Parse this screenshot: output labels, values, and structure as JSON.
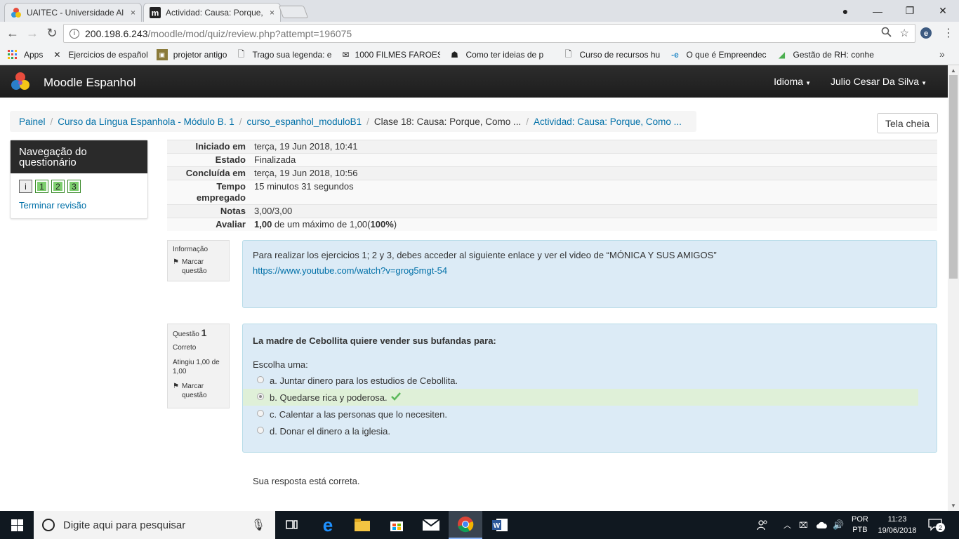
{
  "browser": {
    "tabs": [
      {
        "title": "UAITEC - Universidade Al",
        "close": "×"
      },
      {
        "title": "Actividad: Causa: Porque,",
        "close": "×"
      }
    ],
    "window_controls": {
      "account": "●",
      "minimize": "—",
      "maximize": "❐",
      "close": "✕"
    },
    "url_host": "200.198.6.243",
    "url_path": "/moodle/mod/quiz/review.php?attempt=196075",
    "bookmarks": [
      "Apps",
      "Ejercicios de español",
      "projetor antigo",
      "Trago sua legenda: e",
      "1000 FILMES FAROES",
      "Como ter ideias de p",
      "Curso de recursos hu",
      "O que é Empreendec",
      "Gestão de RH: conhe"
    ],
    "more_bookmarks": "»"
  },
  "moodle": {
    "brand": "Moodle Espanhol",
    "language_menu": "Idioma",
    "user_menu": "Julio Cesar Da Silva",
    "breadcrumb": [
      "Painel",
      "Curso da Língua Espanhola - Módulo B. 1",
      "curso_espanhol_moduloB1",
      "Clase 18: Causa: Porque, Como ...",
      "Actividad: Causa: Porque, Como ..."
    ],
    "fullscreen_label": "Tela cheia",
    "quiz_nav": {
      "title": "Navegação do questionário",
      "buttons": [
        "i",
        "1",
        "2",
        "3"
      ],
      "finish_review": "Terminar revisão"
    },
    "summary": {
      "started_label": "Iniciado em",
      "started_value": "terça, 19 Jun 2018, 10:41",
      "state_label": "Estado",
      "state_value": "Finalizada",
      "completed_label": "Concluída em",
      "completed_value": "terça, 19 Jun 2018, 10:56",
      "time_label": "Tempo empregado",
      "time_value": "15 minutos 31 segundos",
      "marks_label": "Notas",
      "marks_value": "3,00/3,00",
      "grade_label": "Avaliar",
      "grade_bold": "1,00",
      "grade_mid": " de um máximo de 1,00(",
      "grade_pct": "100%",
      "grade_end": ")"
    },
    "info_block": {
      "label": "Informação",
      "flag": "Marcar questão",
      "text": "Para realizar los ejercicios 1; 2 y 3, debes acceder al siguiente enlace y ver el video de “MÓNICA Y SUS AMIGOS”",
      "link": "https://www.youtube.com/watch?v=grog5mgt-54"
    },
    "question1": {
      "label": "Questão",
      "number": "1",
      "state": "Correto",
      "mark": "Atingiu 1,00 de 1,00",
      "flag": "Marcar questão",
      "prompt": "La madre de Cebollita quiere vender sus bufandas para:",
      "choose": "Escolha uma:",
      "options": [
        "a. Juntar dinero para los estudios de Cebollita.",
        "b. Quedarse rica y poderosa.",
        "c. Calentar a las personas que lo necesiten.",
        "d. Donar el dinero a la iglesia."
      ],
      "feedback": "Sua resposta está correta."
    }
  },
  "taskbar": {
    "search_placeholder": "Digite aqui para pesquisar",
    "lang_line1": "POR",
    "lang_line2": "PTB",
    "time": "11:23",
    "date": "19/06/2018",
    "notifications": "2"
  }
}
